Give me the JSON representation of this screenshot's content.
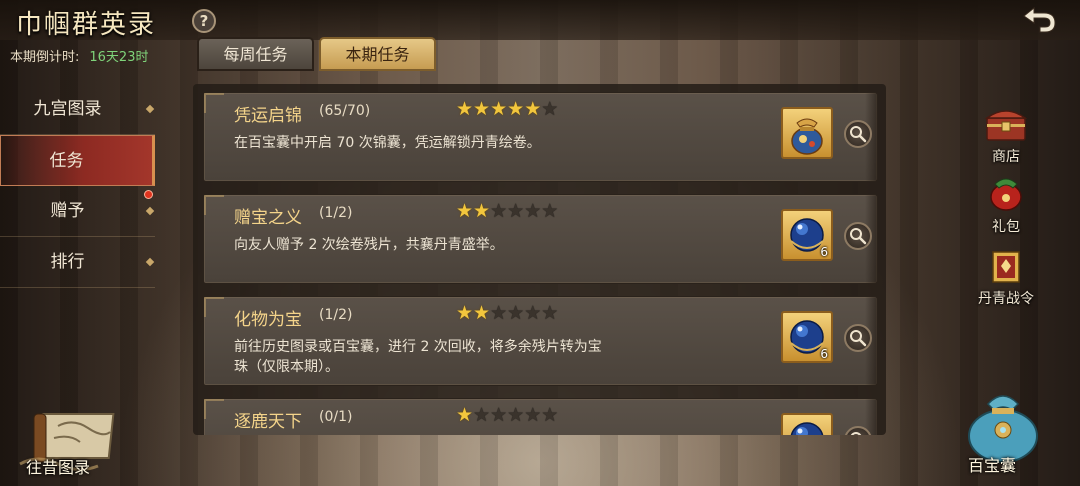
{
  "header": {
    "title": "巾帼群英录",
    "help_glyph": "?",
    "countdown_label": "本期倒计时:",
    "countdown_value": "16天23时"
  },
  "tabs": [
    {
      "label": "每周任务",
      "active": false
    },
    {
      "label": "本期任务",
      "active": true
    }
  ],
  "left_nav": {
    "items": [
      {
        "label": "九宫图录",
        "active": false,
        "badge": false
      },
      {
        "label": "任务",
        "active": true,
        "badge": false
      },
      {
        "label": "赠予",
        "active": false,
        "badge": true
      },
      {
        "label": "排行",
        "active": false,
        "badge": false
      }
    ]
  },
  "tasks": [
    {
      "name": "凭运启锦",
      "progress": "(65/70)",
      "stars": 5,
      "max_stars": 6,
      "desc": "在百宝囊中开启 70 次锦囊，凭运解锁丹青绘卷。",
      "reward_icon": "brocade-bag-icon",
      "reward_count": ""
    },
    {
      "name": "赠宝之义",
      "progress": "(1/2)",
      "stars": 2,
      "max_stars": 6,
      "desc": "向友人赠予 2 次绘卷残片，共襄丹青盛举。",
      "reward_icon": "blue-pearl-icon",
      "reward_count": "6"
    },
    {
      "name": "化物为宝",
      "progress": "(1/2)",
      "stars": 2,
      "max_stars": 6,
      "desc": "前往历史图录或百宝囊，进行 2 次回收，将多余残片转为宝珠（仅限本期）。",
      "reward_icon": "blue-pearl-icon",
      "reward_count": "6"
    },
    {
      "name": "逐鹿天下",
      "progress": "(0/1)",
      "stars": 1,
      "max_stars": 6,
      "desc": "",
      "reward_icon": "blue-pearl-icon",
      "reward_count": ""
    }
  ],
  "side_buttons": [
    {
      "label": "商店",
      "icon": "shop-chest-icon"
    },
    {
      "label": "礼包",
      "icon": "gift-pack-icon"
    },
    {
      "label": "丹青战令",
      "icon": "battle-pass-icon"
    }
  ],
  "bottom": {
    "archive_label": "往昔图录",
    "treasure_label": "百宝囊"
  },
  "colors": {
    "task_name": "#f4d48a",
    "star_on": "#f2c63d",
    "active_tab": "#e6c887",
    "active_nav": "#8d2a22",
    "countdown_value": "#7fd37a"
  }
}
